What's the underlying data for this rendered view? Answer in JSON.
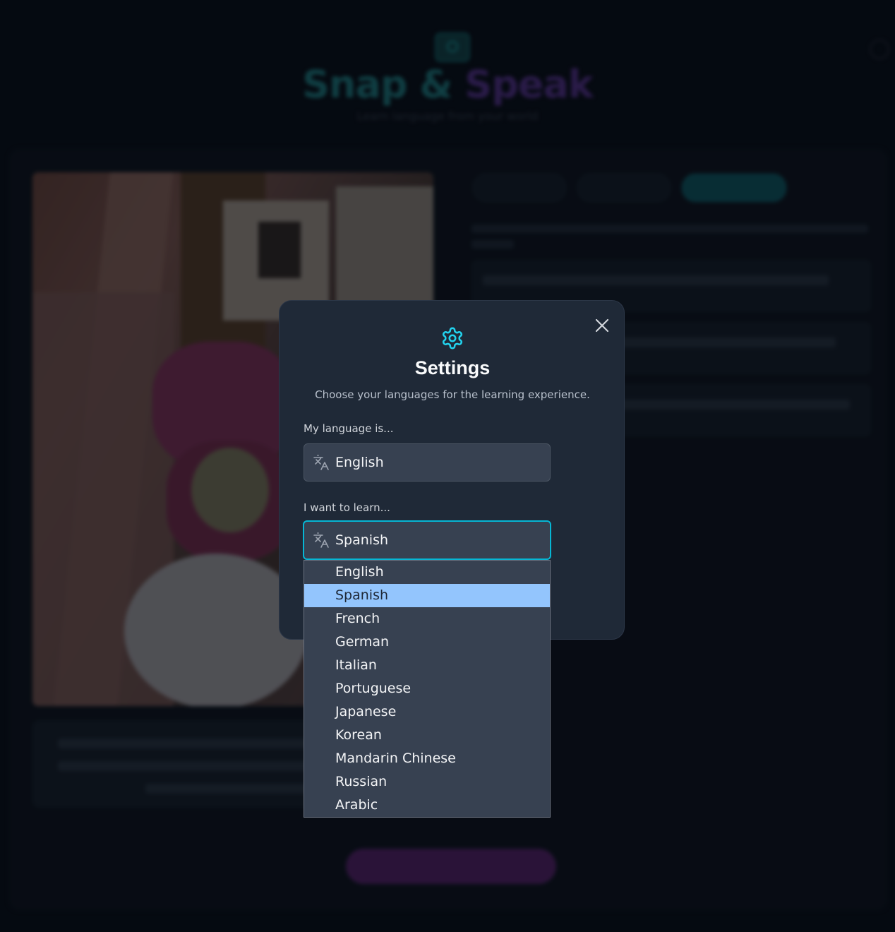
{
  "app": {
    "title_part1": "Snap &",
    "title_part2": "Speak",
    "subtitle": "Learn language from your world"
  },
  "modal": {
    "title": "Settings",
    "subtitle": "Choose your languages for the learning experience.",
    "native_label": "My language is...",
    "native_value": "English",
    "target_label": "I want to learn...",
    "target_value": "Spanish"
  },
  "dropdown": {
    "options": [
      "English",
      "Spanish",
      "French",
      "German",
      "Italian",
      "Portuguese",
      "Japanese",
      "Korean",
      "Mandarin Chinese",
      "Russian",
      "Arabic"
    ],
    "selected": "Spanish"
  },
  "colors": {
    "accent": "#06b6d4",
    "modal_bg": "#1f2937",
    "select_bg": "#374151",
    "highlight": "#93c5fd"
  },
  "icons": {
    "close": "close-icon",
    "gear": "gear-icon",
    "translate": "translate-icon"
  }
}
